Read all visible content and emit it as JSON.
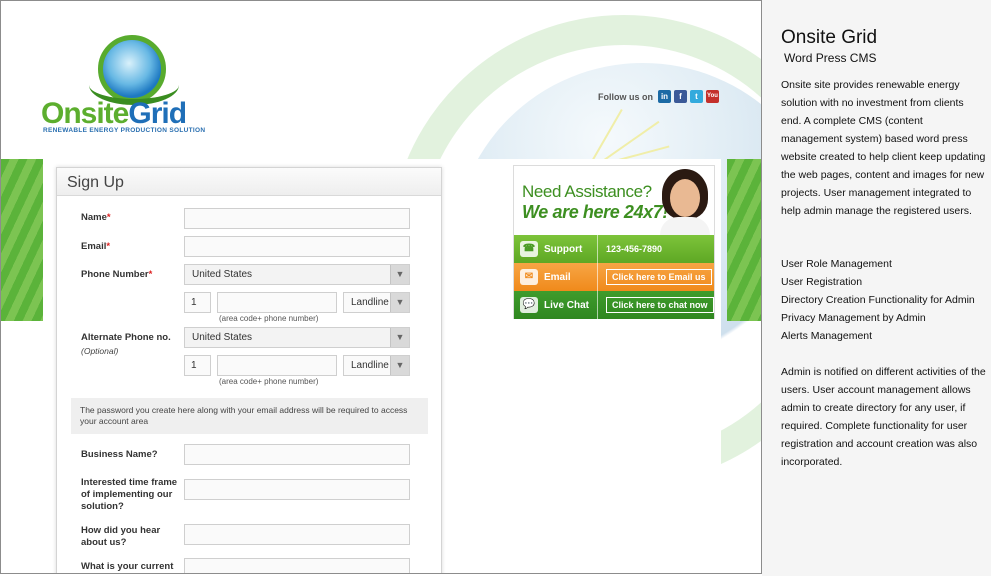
{
  "site": {
    "logo": {
      "name_part1": "Onsite",
      "name_part2": "Grid",
      "tagline": "RENEWABLE ENERGY PRODUCTION SOLUTION"
    },
    "follow": {
      "label": "Follow us on",
      "icons": [
        "linkedin-icon",
        "facebook-icon",
        "twitter-icon",
        "youtube-icon"
      ]
    },
    "signup": {
      "title": "Sign Up",
      "name_label": "Name",
      "email_label": "Email",
      "required_mark": "*",
      "phone_label": "Phone Number",
      "country_value": "United States",
      "country_code": "1",
      "phone_type": "Landline",
      "phone_hint": "(area code+ phone number)",
      "alt_phone_label": "Alternate Phone no.",
      "optional_label": "(Optional)",
      "alt_country_value": "United States",
      "alt_country_code": "1",
      "alt_phone_type": "Landline",
      "alt_phone_hint": "(area code+ phone number)",
      "password_note": "The password you create here along with your email address will be required to access your account area",
      "business_label": "Business Name?",
      "timeframe_label": "Interested time frame of implementing our solution?",
      "hear_label": "How did you hear about us?",
      "current_label": "What is your current"
    },
    "assist": {
      "title_line1": "Need Assistance?",
      "title_line2": "We are here 24x7!",
      "support_label": "Support",
      "support_phone": "123-456-7890",
      "email_label": "Email",
      "email_button": "Click here to Email us",
      "chat_label": "Live Chat",
      "chat_button": "Click here to chat now"
    },
    "colors": {
      "green": "#5cae2e",
      "blue": "#1f6fb8",
      "orange": "#f08a1b"
    }
  },
  "description": {
    "title": "Onsite Grid",
    "subtitle": "Word Press CMS",
    "para1": "Onsite site provides renewable energy solution with no investment from clients end. A complete CMS (content management system) based word press website created to help client keep updating the web pages, content and images for new projects.  User management integrated to help admin manage the registered users.",
    "features": [
      "User Role Management",
      "User Registration",
      "Directory Creation Functionality for Admin",
      "Privacy Management by Admin",
      "Alerts Management"
    ],
    "para2": "Admin is notified on different activities of the users. User account management allows admin to create directory for any user, if required.  Complete functionality for user registration and account creation was also incorporated."
  }
}
